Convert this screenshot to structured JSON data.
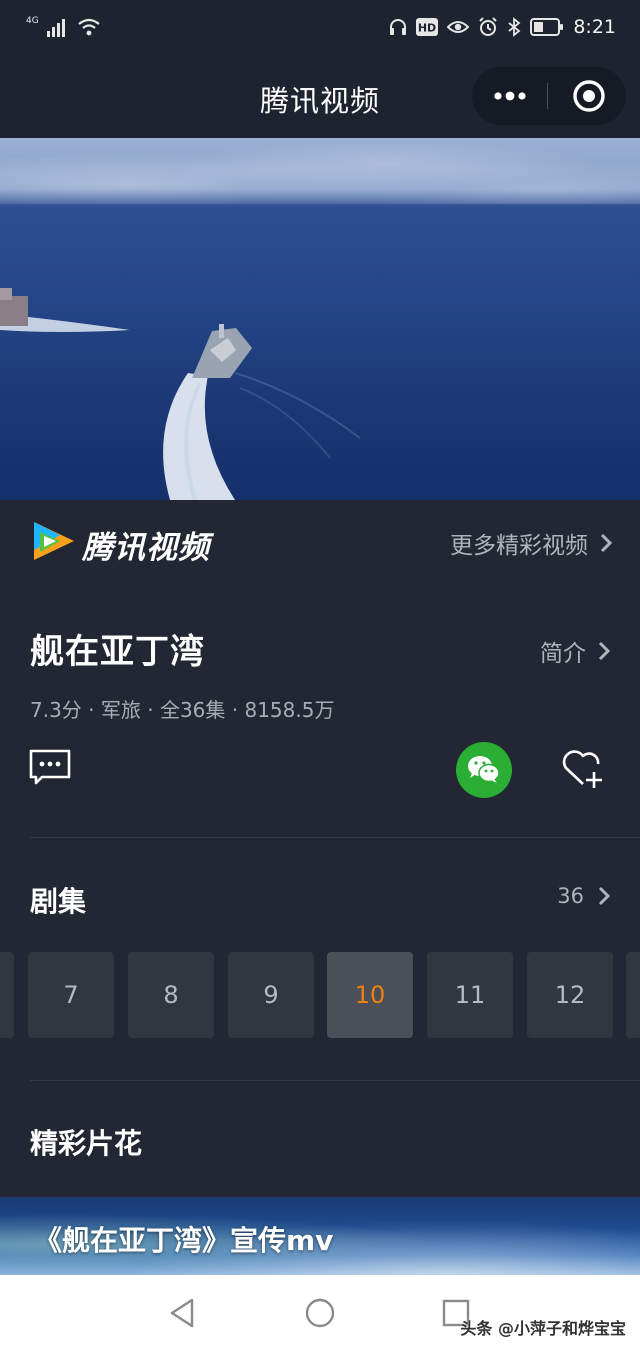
{
  "status_bar": {
    "network": "4G",
    "time": "8:21",
    "icons": [
      "signal-icon",
      "wifi-icon",
      "headset-icon",
      "hd-icon",
      "eye-icon",
      "alarm-icon",
      "bluetooth-icon",
      "battery-icon"
    ]
  },
  "nav": {
    "title": "腾讯视频",
    "more_icon": "more-dots-icon",
    "close_icon": "mini-program-close-icon"
  },
  "video": {
    "description_icon": "video-player"
  },
  "brand": {
    "name": "腾讯视频",
    "more_videos": "更多精彩视频"
  },
  "show": {
    "title": "舰在亚丁湾",
    "intro_label": "简介",
    "meta": "7.3分 · 军旅 · 全36集 · 8158.5万"
  },
  "actions": {
    "comment_icon": "comment-icon",
    "share_icon": "wechat-icon",
    "favorite_icon": "heart-add-icon"
  },
  "episodes": {
    "section_title": "剧集",
    "total": "36",
    "items": [
      "7",
      "8",
      "9",
      "10",
      "11",
      "12"
    ],
    "active": "10"
  },
  "highlights": {
    "section_title": "精彩片花",
    "banner_title": "《舰在亚丁湾》宣传mv"
  },
  "watermark": "头条 @小萍子和烨宝宝",
  "colors": {
    "background": "#222733",
    "active_episode": "#ee7f13",
    "wechat_green": "#2aae33"
  }
}
